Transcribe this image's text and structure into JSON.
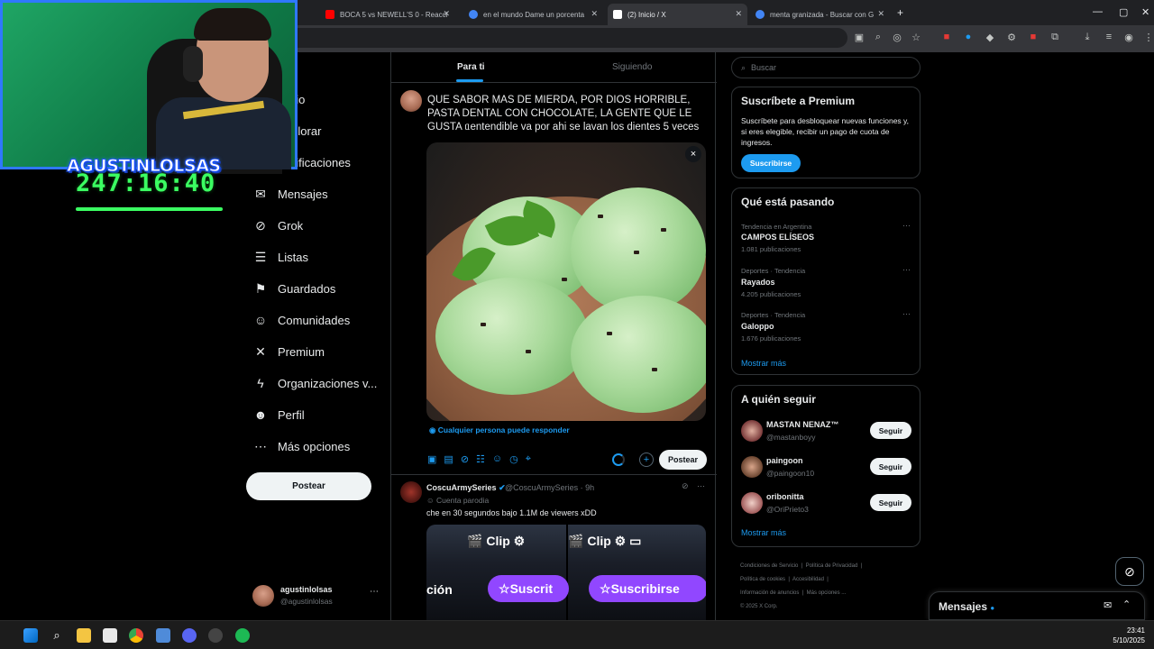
{
  "browser": {
    "tabs": [
      {
        "label": "BOCA 5 vs NEWELL'S 0 - Reacci",
        "color": "#ff0000"
      },
      {
        "label": "en el mundo Dame un porcenta",
        "color": "#4285f4"
      },
      {
        "label": "(2) Inicio / X",
        "color": "#ffffff"
      },
      {
        "label": "menta granizada - Buscar con G",
        "color": "#4285f4"
      }
    ],
    "new_tab": "+"
  },
  "stream": {
    "name": "AGUSTINLOLSAS",
    "timer": "247:16:40"
  },
  "nav": {
    "items": [
      {
        "label": "Inicio",
        "icon": "home-icon",
        "glyph": "⌂"
      },
      {
        "label": "Explorar",
        "icon": "search-icon",
        "glyph": "⌕"
      },
      {
        "label": "Notificaciones",
        "icon": "bell-icon",
        "glyph": "🔔"
      },
      {
        "label": "Mensajes",
        "icon": "mail-icon",
        "glyph": "✉"
      },
      {
        "label": "Grok",
        "icon": "grok-icon",
        "glyph": "⊘"
      },
      {
        "label": "Listas",
        "icon": "list-icon",
        "glyph": "☰"
      },
      {
        "label": "Guardados",
        "icon": "bookmark-icon",
        "glyph": "⚑"
      },
      {
        "label": "Comunidades",
        "icon": "people-icon",
        "glyph": "☺"
      },
      {
        "label": "Premium",
        "icon": "x-logo-icon",
        "glyph": "✕"
      },
      {
        "label": "Organizaciones v...",
        "icon": "lightning-icon",
        "glyph": "ϟ"
      },
      {
        "label": "Perfil",
        "icon": "person-icon",
        "glyph": "☻"
      },
      {
        "label": "Más opciones",
        "icon": "more-circle-icon",
        "glyph": "⋯"
      }
    ],
    "post_label": "Postear",
    "user": {
      "name": "agustinlolsas",
      "handle": "@agustinlolsas",
      "more": "⋯"
    }
  },
  "timeline": {
    "tab_for_you": "Para ti",
    "tab_following": "Siguiendo",
    "compose_text": "QUE SABOR MAS DE MIERDA, POR DIOS HORRIBLE, PASTA DENTAL CON CHOCOLATE, LA GENTE QUE LE GUSTA ᥲentendible va por ahi se lavan los dientes 5 veces",
    "close": "×",
    "reply_note": "Cualquier persona puede responder",
    "post_small": "Postear",
    "tweet2": {
      "name": "CoscuArmySeries",
      "handle": "@CoscuArmySeries · 9h",
      "sub": "Cuenta parodia",
      "text": "che en 30 segundos bajo 1.1M de viewers xDD",
      "clip_label": "Clip",
      "subscribe_label_cut": "Suscrit",
      "subscribe_label": "Suscribirse",
      "left_word": "ción"
    }
  },
  "right": {
    "search_placeholder": "Buscar",
    "premium": {
      "title": "Suscríbete a Premium",
      "text": "Suscríbete para desbloquear nuevas funciones y, si eres elegible, recibir un pago de cuota de ingresos.",
      "button": "Suscribirse"
    },
    "trends": {
      "title": "Qué está pasando",
      "items": [
        {
          "meta": "Tendencia en Argentina",
          "title": "CAMPOS ELÍSEOS",
          "count": "1.081 publicaciones"
        },
        {
          "meta": "Deportes · Tendencia",
          "title": "Rayados",
          "count": "4.205 publicaciones"
        },
        {
          "meta": "Deportes · Tendencia",
          "title": "Galoppo",
          "count": "1.676 publicaciones"
        }
      ],
      "show_more": "Mostrar más"
    },
    "follow": {
      "title": "A quién seguir",
      "items": [
        {
          "name": "MASTAN NENAZ™",
          "handle": "@mastanboyy",
          "button": "Seguir"
        },
        {
          "name": "paingoon",
          "handle": "@paingoon10",
          "button": "Seguir"
        },
        {
          "name": "oribonitta",
          "handle": "@OriPrieto3",
          "button": "Seguir"
        }
      ],
      "show_more": "Mostrar más"
    },
    "footer": [
      "Condiciones de Servicio",
      "Política de Privacidad",
      "Política de cookies",
      "Accesibilidad",
      "Información de anuncios",
      "Más opciones ...",
      "© 2025 X Corp."
    ],
    "messages_dock": "Mensajes"
  },
  "taskbar": {
    "time": "23:41",
    "date": "5/10/2025"
  }
}
